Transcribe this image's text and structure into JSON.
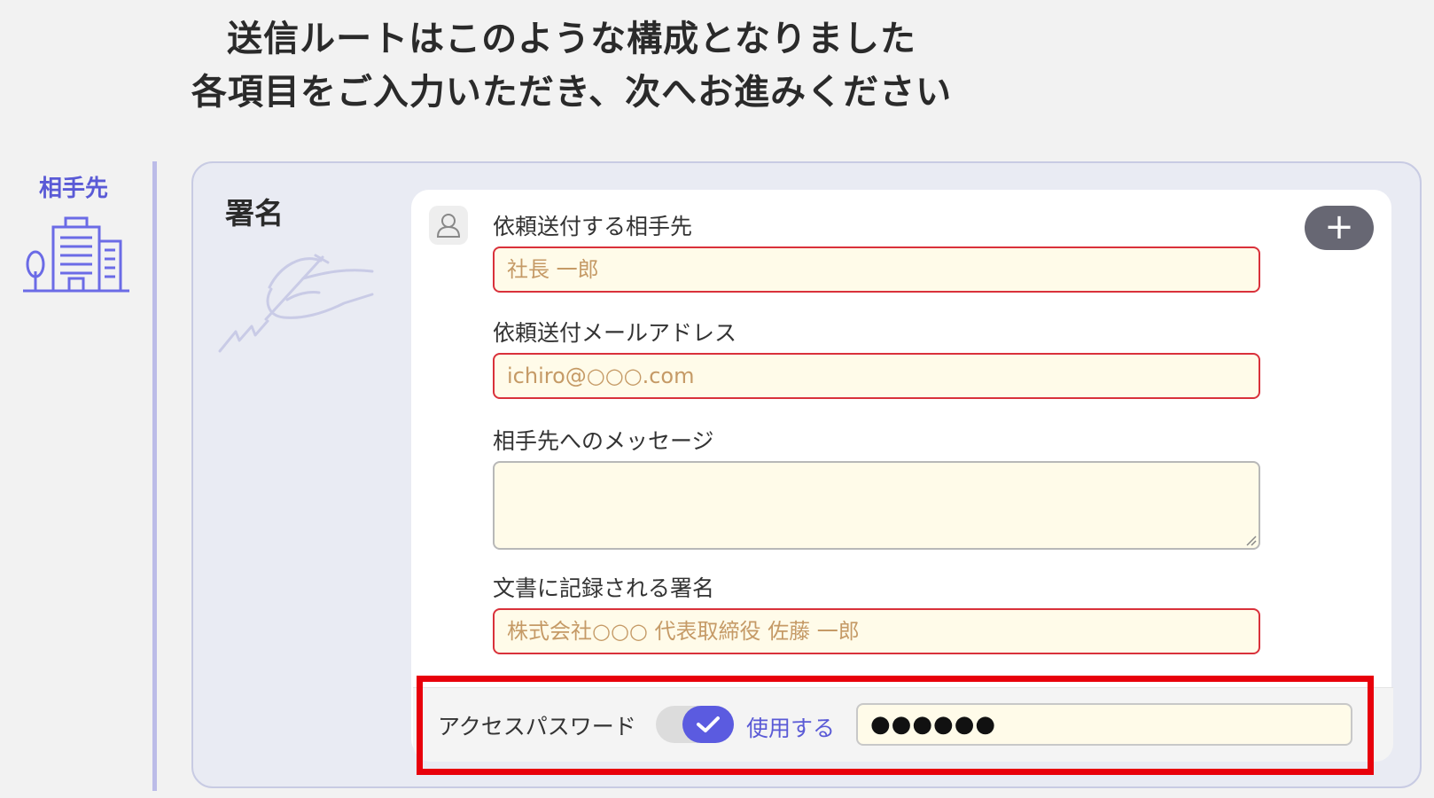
{
  "heading": {
    "line1": "送信ルートはこのような構成となりました",
    "line2": "各項目をご入力いただき、次へお進みください"
  },
  "sidebar": {
    "label": "相手先",
    "icon": "building-icon"
  },
  "panel": {
    "title": "署名",
    "illustration": "hand-signing-icon"
  },
  "form": {
    "recipient_icon": "person-icon",
    "add_button": "+",
    "recipient_name": {
      "label": "依頼送付する相手先",
      "placeholder": "社長 一郎"
    },
    "recipient_email": {
      "label": "依頼送付メールアドレス",
      "placeholder": "ichiro@○○○.com"
    },
    "message": {
      "label": "相手先へのメッセージ",
      "value": ""
    },
    "signature": {
      "label": "文書に記録される署名",
      "placeholder": "株式会社○○○ 代表取締役 佐藤 一郎"
    }
  },
  "access_password": {
    "label": "アクセスパスワード",
    "toggle_label": "使用する",
    "toggle_on": true,
    "value": "●●●●●●"
  },
  "colors": {
    "accent": "#5b5be0",
    "required_border": "#d9313b",
    "field_bg": "#fffbe9",
    "highlight": "#e8000b"
  }
}
